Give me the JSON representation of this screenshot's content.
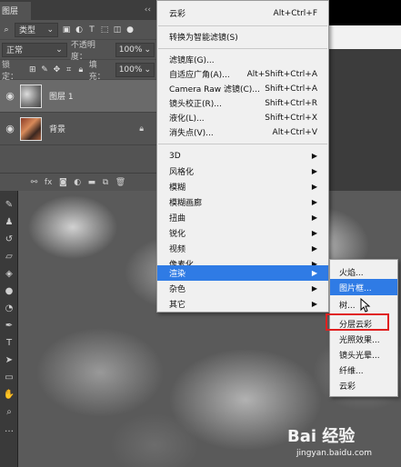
{
  "layers_panel": {
    "tab_label": "图层",
    "tab_arrows": "‹‹",
    "filter_kind": "类型",
    "blend_mode": "正常",
    "opacity_label": "不透明度：",
    "opacity_value": "100%",
    "lock_label": "锁定：",
    "fill_label": "填充：",
    "fill_value": "100%",
    "layers": [
      {
        "name": "图层 1",
        "selected": true
      },
      {
        "name": "背景",
        "selected": false
      }
    ]
  },
  "filter_menu": {
    "items": [
      {
        "label": "云彩",
        "shortcut": "Alt+Ctrl+F"
      },
      {
        "label": "转换为智能滤镜(S)",
        "shortcut": ""
      },
      {
        "label": "滤镜库(G)...",
        "shortcut": ""
      },
      {
        "label": "自适应广角(A)...",
        "shortcut": "Alt+Shift+Ctrl+A"
      },
      {
        "label": "Camera Raw 滤镜(C)...",
        "shortcut": "Shift+Ctrl+A"
      },
      {
        "label": "镜头校正(R)...",
        "shortcut": "Shift+Ctrl+R"
      },
      {
        "label": "液化(L)...",
        "shortcut": "Shift+Ctrl+X"
      },
      {
        "label": "消失点(V)...",
        "shortcut": "Alt+Ctrl+V"
      },
      {
        "label": "3D"
      },
      {
        "label": "风格化"
      },
      {
        "label": "模糊"
      },
      {
        "label": "模糊画廊"
      },
      {
        "label": "扭曲"
      },
      {
        "label": "锐化"
      },
      {
        "label": "视频"
      },
      {
        "label": "像素化"
      },
      {
        "label": "渲染"
      },
      {
        "label": "杂色"
      },
      {
        "label": "其它"
      }
    ]
  },
  "render_submenu": {
    "items": [
      "火焰...",
      "图片框...",
      "树...",
      "分层云彩",
      "光照效果...",
      "镜头光晕...",
      "纤维...",
      "云彩"
    ]
  },
  "watermark": {
    "brand": "Bai 经验",
    "url": "jingyan.baidu.com"
  }
}
